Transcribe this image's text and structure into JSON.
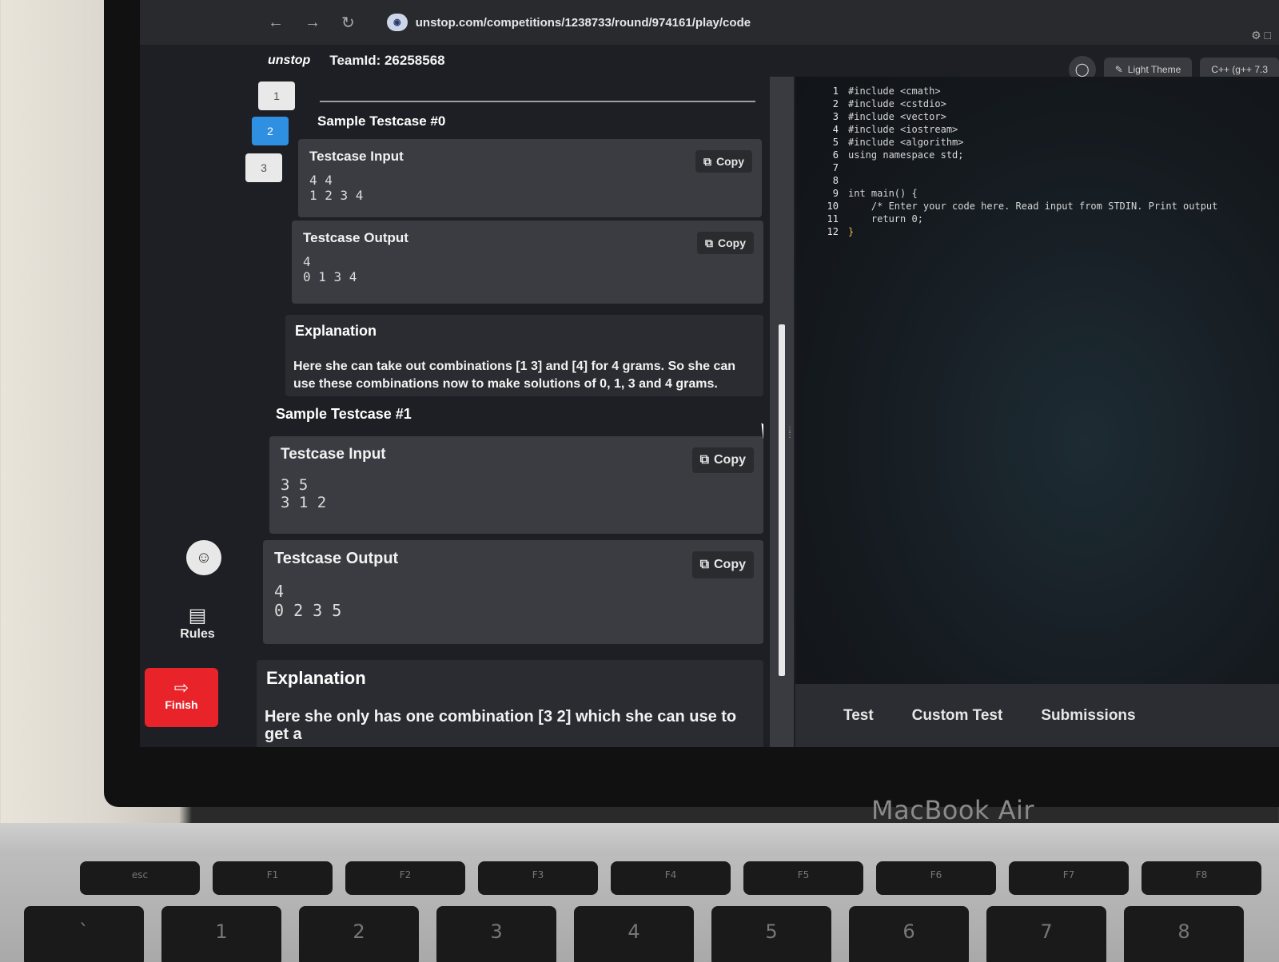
{
  "browser": {
    "back_icon": "arrow-left-icon",
    "forward_icon": "arrow-right-icon",
    "reload_icon": "reload-icon",
    "url": "unstop.com/competitions/1238733/round/974161/play/code"
  },
  "header": {
    "logo": "unstop",
    "team_id": "TeamId: 26258568",
    "light_theme_label": "Light Theme",
    "language_label": "C++ (g++ 7.3"
  },
  "rail": {
    "questions": [
      "1",
      "2",
      "3"
    ],
    "active_question": "2",
    "rules_label": "Rules",
    "finish_label": "Finish"
  },
  "problem": {
    "testcase0": {
      "title": "Sample Testcase #0",
      "input_label": "Testcase Input",
      "input_value": "4 4\n1 2 3 4",
      "output_label": "Testcase Output",
      "output_value": "4\n0 1 3 4",
      "copy_label": "Copy",
      "explanation_label": "Explanation",
      "explanation": "Here she can take out combinations [1 3] and [4] for 4 grams. So she can use these combinations now to make solutions of 0, 1, 3 and 4 grams."
    },
    "testcase1": {
      "title": "Sample Testcase #1",
      "input_label": "Testcase Input",
      "input_value": "3 5\n3 1 2",
      "output_label": "Testcase Output",
      "output_value": "4\n0 2 3 5",
      "copy_label": "Copy",
      "explanation_label": "Explanation",
      "explanation": "Here she only has one combination [3 2] which she can use to get a"
    }
  },
  "editor": {
    "line_numbers": [
      "1",
      "2",
      "3",
      "4",
      "5",
      "6",
      "7",
      "8",
      "9",
      "10",
      "11",
      "12"
    ],
    "lines": [
      "#include <cmath>",
      "#include <cstdio>",
      "#include <vector>",
      "#include <iostream>",
      "#include <algorithm>",
      "using namespace std;",
      "",
      "",
      "int main() {",
      "    /* Enter your code here. Read input from STDIN. Print output",
      "    return 0;",
      "}"
    ],
    "tabs": [
      "Test",
      "Custom Test",
      "Submissions"
    ]
  },
  "device": {
    "brand_label": "MacBook Air",
    "function_keys": [
      "esc",
      "F1",
      "F2",
      "F3",
      "F4",
      "F5",
      "F6",
      "F7",
      "F8"
    ],
    "number_keys": [
      "~\n`",
      "!\n1",
      "@\n2",
      "#\n3",
      "$\n4",
      "%\n5",
      "^\n6",
      "&\n7",
      "*\n8"
    ]
  }
}
